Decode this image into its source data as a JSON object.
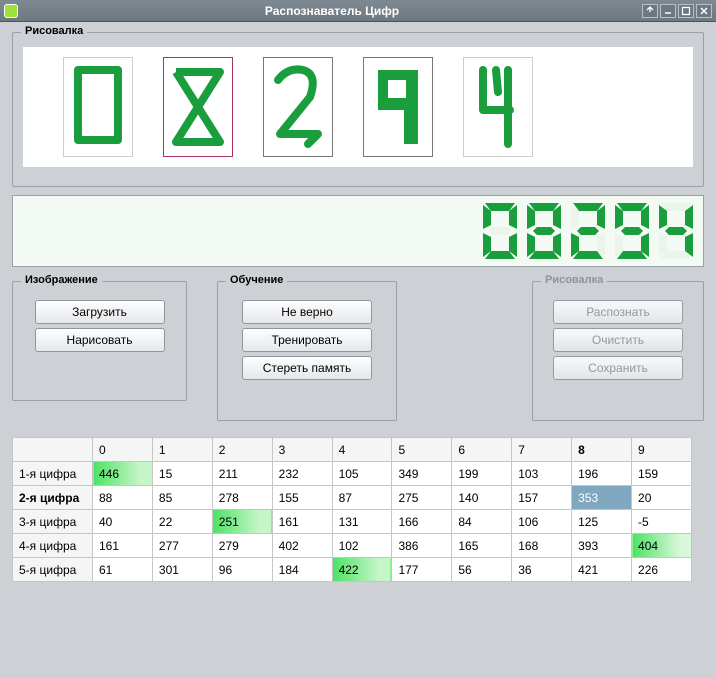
{
  "window": {
    "title": "Распознаватель Цифр"
  },
  "drawing": {
    "legend": "Рисовалка"
  },
  "display": {
    "digits": [
      0,
      8,
      2,
      9,
      4
    ]
  },
  "panels": {
    "image": {
      "legend": "Изображение",
      "load": "Загрузить",
      "draw": "Нарисовать"
    },
    "train": {
      "legend": "Обучение",
      "wrong": "Не верно",
      "train_btn": "Тренировать",
      "erase": "Стереть память"
    },
    "drawctl": {
      "legend": "Рисовалка",
      "recog": "Распознать",
      "clear": "Очистить",
      "save": "Сохранить"
    }
  },
  "table": {
    "col_headers": [
      "0",
      "1",
      "2",
      "3",
      "4",
      "5",
      "6",
      "7",
      "8",
      "9"
    ],
    "bold_col": 8,
    "selected": {
      "row": 1,
      "col": 8
    },
    "rows": [
      {
        "label": "1-я цифра",
        "bold": false,
        "hl": 0,
        "cells": [
          "446",
          "15",
          "211",
          "232",
          "105",
          "349",
          "199",
          "103",
          "196",
          "159"
        ]
      },
      {
        "label": "2-я цифра",
        "bold": true,
        "hl": -1,
        "cells": [
          "88",
          "85",
          "278",
          "155",
          "87",
          "275",
          "140",
          "157",
          "353",
          "20"
        ]
      },
      {
        "label": "3-я цифра",
        "bold": false,
        "hl": 2,
        "cells": [
          "40",
          "22",
          "251",
          "161",
          "131",
          "166",
          "84",
          "106",
          "125",
          "-5"
        ]
      },
      {
        "label": "4-я цифра",
        "bold": false,
        "hl": 9,
        "cells": [
          "161",
          "277",
          "279",
          "402",
          "102",
          "386",
          "165",
          "168",
          "393",
          "404"
        ]
      },
      {
        "label": "5-я цифра",
        "bold": false,
        "hl": 4,
        "cells": [
          "61",
          "301",
          "96",
          "184",
          "422",
          "177",
          "56",
          "36",
          "421",
          "226"
        ]
      }
    ]
  }
}
